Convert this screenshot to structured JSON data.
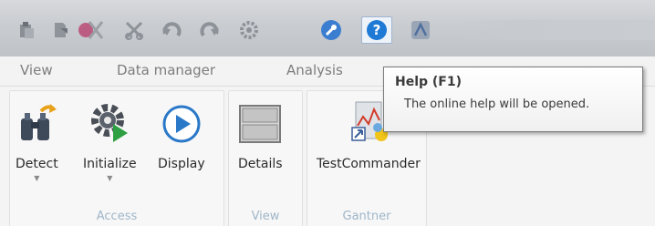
{
  "quick_access": {
    "buttons": [
      {
        "name": "paste-icon"
      },
      {
        "name": "copy-icon"
      },
      {
        "name": "delete-icon"
      },
      {
        "name": "cut-icon"
      },
      {
        "name": "undo-icon"
      },
      {
        "name": "redo-icon"
      },
      {
        "name": "settings-icon"
      },
      {
        "name": "wrench-icon"
      },
      {
        "name": "help-icon"
      },
      {
        "name": "about-icon"
      }
    ]
  },
  "tabs": [
    "View",
    "Data manager",
    "Analysis"
  ],
  "ribbon": {
    "groups": [
      {
        "label": "Access",
        "buttons": [
          {
            "label": "Detect",
            "has_dropdown": true
          },
          {
            "label": "Initialize",
            "has_dropdown": true
          },
          {
            "label": "Display",
            "has_dropdown": false
          }
        ]
      },
      {
        "label": "View",
        "buttons": [
          {
            "label": "Details",
            "has_dropdown": false
          }
        ]
      },
      {
        "label": "Gantner",
        "buttons": [
          {
            "label": "TestCommander",
            "has_dropdown": false
          }
        ]
      }
    ]
  },
  "tooltip": {
    "title": "Help (F1)",
    "body": "The online help will be opened."
  },
  "colors": {
    "help_blue": "#1f7ad6",
    "group_label": "#9fb6c9",
    "display_blue": "#2a78c8"
  }
}
